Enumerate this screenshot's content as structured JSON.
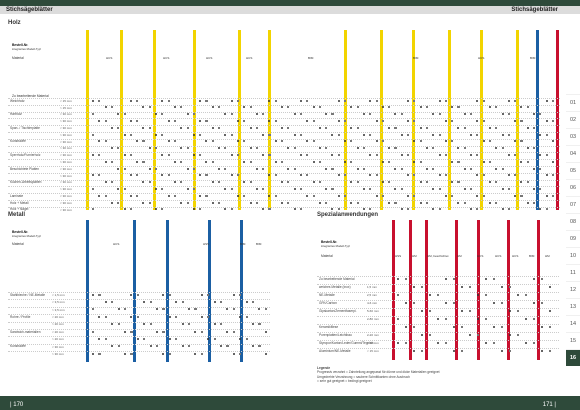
{
  "header": {
    "left_title": "Stichsägeblätter",
    "right_title": "Stichsägeblätter"
  },
  "sections": {
    "holz": "Holz",
    "metall": "Metall",
    "spezial": "Spezialanwendungen"
  },
  "labels": {
    "bestell_nr": "Bestell-Nr.",
    "integriertes_typ": "integriertes Modell-Typ!",
    "material": "Material",
    "zu_bearbeitende": "Zu bearbeitende Material",
    "holz_metall": "Holz + Metall",
    "holz_naegel": "Holz + Nägel"
  },
  "holz_rows": [
    {
      "name": "Weichholz",
      "sub": "< 15 mm"
    },
    {
      "name": "",
      "sub": "> 15 mm"
    },
    {
      "name": "Hartholz",
      "sub": "< 30 mm"
    },
    {
      "name": "",
      "sub": "> 30 mm"
    },
    {
      "name": "Span- / Tischlerplatte",
      "sub": "< 30 mm"
    },
    {
      "name": "",
      "sub": "> 30 mm"
    },
    {
      "name": "Kunststoffe",
      "sub": "< 30 mm"
    },
    {
      "name": "",
      "sub": "> 30 mm"
    },
    {
      "name": "Sperrholz/Furnierholz",
      "sub": "< 30 mm"
    },
    {
      "name": "",
      "sub": "> 30 mm"
    },
    {
      "name": "Beschichtete Platten",
      "sub": "< 30 mm"
    },
    {
      "name": "",
      "sub": "> 30 mm"
    },
    {
      "name": "Küchen-Arbeitsplatten",
      "sub": "< 30 mm"
    },
    {
      "name": "",
      "sub": "> 30 mm"
    },
    {
      "name": "Laminate",
      "sub": "< 30 mm"
    },
    {
      "name": "Holz + Metall",
      "sub": "< 30 mm"
    },
    {
      "name": "Holz + Nägel",
      "sub": "< 30 mm"
    }
  ],
  "metall_rows": [
    {
      "name": "Stahlbleche / NE-Metalle",
      "sub": "< 1,5 mm"
    },
    {
      "name": "",
      "sub": "< 3,5 mm"
    },
    {
      "name": "",
      "sub": "> 3,5 mm"
    },
    {
      "name": "Rohre / Profile",
      "sub": "< 20 mm"
    },
    {
      "name": "",
      "sub": "> 20 mm"
    },
    {
      "name": "Sandwich-materialien",
      "sub": "< 20 mm"
    },
    {
      "name": "",
      "sub": "> 20 mm"
    },
    {
      "name": "Kunststoffe",
      "sub": "< 30 mm"
    },
    {
      "name": "",
      "sub": "> 30 mm"
    }
  ],
  "spezial_rows": [
    {
      "name": "Zu bearbeitende Material",
      "sub": ""
    },
    {
      "name": "weiches Metalle (inox)",
      "sub": "1,5 mm"
    },
    {
      "name": "NE-Metalle",
      "sub": "2,5 mm"
    },
    {
      "name": "GFK/Carbon",
      "sub": "4-6 mm"
    },
    {
      "name": "Gipskarton/Zementfaserpl.",
      "sub": "5-60 mm"
    },
    {
      "name": "",
      "sub": "2-80 mm"
    },
    {
      "name": "Keramikfliese",
      "sub": ""
    },
    {
      "name": "Porenplatten/Leichtbau",
      "sub": "2-20 mm"
    },
    {
      "name": "Styropor/Karton/Leder/Gummi/Teppich",
      "sub": "< 60 mm"
    },
    {
      "name": "Aluminium/NE-Metalle",
      "sub": "< 15 mm"
    }
  ],
  "holz_materials": [
    "HCS",
    "HCS",
    "HCS",
    "HCS",
    "BIM",
    "BIM",
    "HCS",
    "BIM"
  ],
  "metall_materials": [
    "HCS",
    "HSS",
    "BIM",
    "BIM"
  ],
  "spezial_materials": [
    "HSS",
    "HM",
    "HM, beschichtet",
    "HM",
    "HCS",
    "HCS",
    "HCS",
    "BIM",
    "HM"
  ],
  "legend": {
    "title": "Legende",
    "line1": "Progressiv verzahnt =   Zahnteilung angepasst für dünne und dicke Materialien geeignet",
    "line2": "Umgedrehte Verzahnung =   saubere Schnittkanten ohne Ausbruch",
    "line3": "=  sehr gut geeignet      =  bedingt geeignet"
  },
  "tabs": [
    "01",
    "02",
    "03",
    "04",
    "05",
    "06",
    "07",
    "08",
    "09",
    "10",
    "11",
    "12",
    "13",
    "14",
    "15",
    "16"
  ],
  "active_tab": "16",
  "page_left": "| 170",
  "page_right": "171 |"
}
